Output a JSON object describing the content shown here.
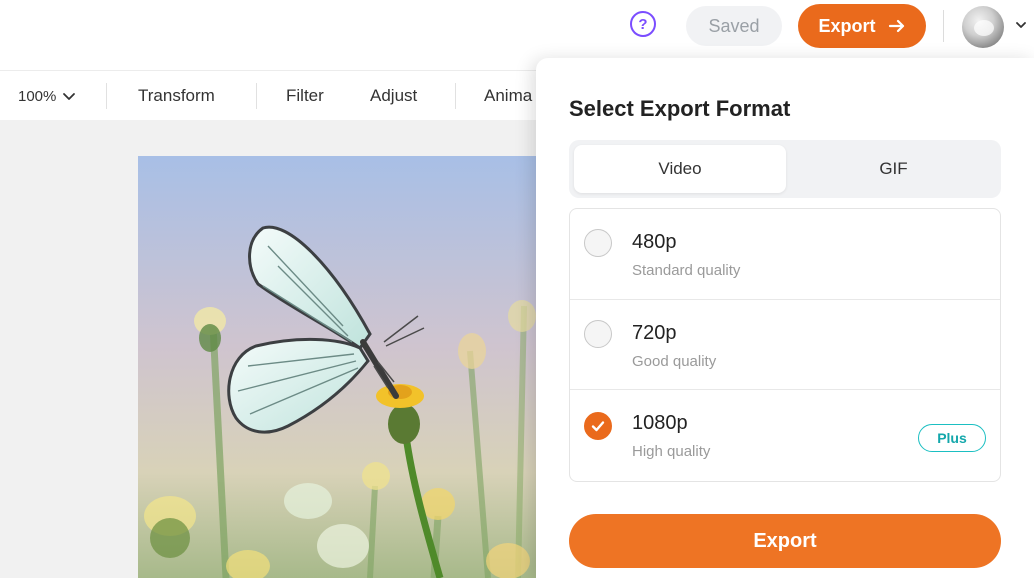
{
  "header": {
    "help_icon": "question-circle-icon",
    "help_glyph": "?",
    "saved_label": "Saved",
    "export_label": "Export",
    "export_icon": "arrow-right-icon",
    "avatar_icon": "user-avatar",
    "avatar_caret_icon": "chevron-down-icon"
  },
  "toolbar": {
    "zoom_value": "100%",
    "zoom_caret_icon": "chevron-down-icon",
    "items": [
      "Transform",
      "Filter",
      "Adjust",
      "Anima"
    ]
  },
  "canvas": {
    "image": "butterfly-on-flower-photo"
  },
  "export_panel": {
    "title": "Select Export Format",
    "tabs": [
      {
        "label": "Video",
        "active": true
      },
      {
        "label": "GIF",
        "active": false
      }
    ],
    "options": [
      {
        "resolution": "480p",
        "description": "Standard quality",
        "selected": false,
        "badge": ""
      },
      {
        "resolution": "720p",
        "description": "Good quality",
        "selected": false,
        "badge": ""
      },
      {
        "resolution": "1080p",
        "description": "High quality",
        "selected": true,
        "badge": "Plus"
      }
    ],
    "export_button_label": "Export"
  },
  "colors": {
    "accent_orange": "#ea6a1c",
    "help_purple": "#7b4dff",
    "plus_teal": "#1bbfc2"
  }
}
